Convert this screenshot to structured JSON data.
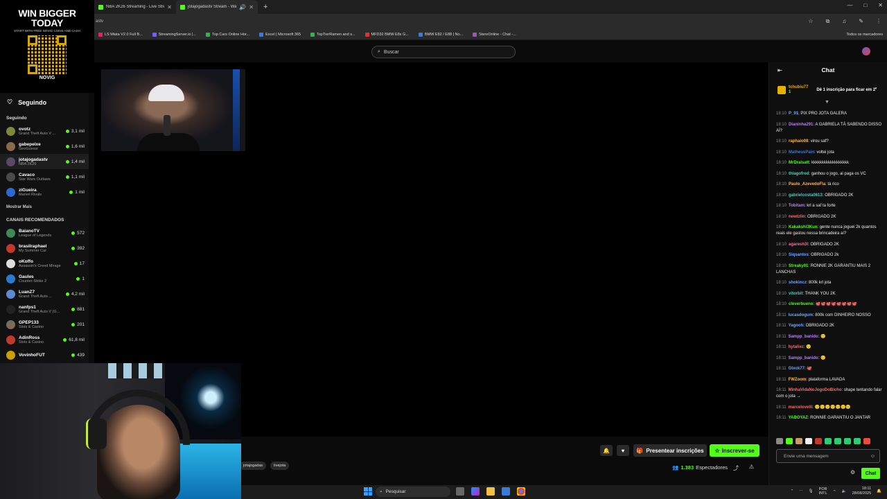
{
  "browser": {
    "tabs": [
      {
        "title": "NBA 2K26 Streaming - Live Stre",
        "active": false
      },
      {
        "title": "jotajogadastv Stream - Wa",
        "active": true
      }
    ],
    "new_tab": "+",
    "window_controls": [
      "—",
      "□",
      "✕"
    ],
    "address": "astv",
    "bookmarks": [
      {
        "label": "LS Miata V2.0 Full B...",
        "color": "#e0245e"
      },
      {
        "label": "StreamingServer.io |...",
        "color": "#7b5cff"
      },
      {
        "label": "Top Cars Online Hor...",
        "color": "#36b24a"
      },
      {
        "label": "Excel | Microsoft 365",
        "color": "#3a7bd5"
      },
      {
        "label": "TopTierRamen and s...",
        "color": "#36b24a"
      },
      {
        "label": "MFD32 BMW E8x G...",
        "color": "#d33"
      },
      {
        "label": "BMW E82 / E88 | No...",
        "color": "#3a7bd5"
      },
      {
        "label": "StereOnline - Chat -...",
        "color": "#9b59b6"
      }
    ],
    "all_bookmarks": "Todos os marcadores"
  },
  "ad": {
    "headline_1": "WIN BIGGER",
    "headline_2": "TODAY",
    "tagline": "START WITH FREE NOVIG COINS AND CASH",
    "brand": "NOVIG"
  },
  "search": {
    "placeholder": "Buscar"
  },
  "sidebar": {
    "following_title": "Seguindo",
    "section_following": "Seguindo",
    "following": [
      {
        "name": "ovotz",
        "game": "Grand Theft Auto V ...",
        "viewers": "3,1 mil",
        "color": "#7a8a3a"
      },
      {
        "name": "gabepeixe",
        "game": "GeoGuessr",
        "viewers": "1,6 mil",
        "color": "#8a6a4a"
      },
      {
        "name": "jotajogadastv",
        "game": "NBA 2K26",
        "viewers": "1,4 mil",
        "color": "#5a4a6a"
      },
      {
        "name": "Cavaco",
        "game": "Star Wars Outlaws",
        "viewers": "1,1 mil",
        "color": "#4a4a4a"
      },
      {
        "name": "ziGueira",
        "game": "Marvel Rivals",
        "viewers": "1 mil",
        "color": "#2a6ad0"
      }
    ],
    "show_more": "Mostrar Mais",
    "section_recommended": "CANAIS RECOMENDADOS",
    "recommended": [
      {
        "name": "BaianoTV",
        "game": "League of Legends",
        "viewers": "572",
        "color": "#3a8a5a"
      },
      {
        "name": "brasilraphael",
        "game": "My Summer Car",
        "viewers": "392",
        "color": "#c0392b"
      },
      {
        "name": "oKoffo",
        "game": "Assassin's Creed Mirage",
        "viewers": "17",
        "color": "#ddd"
      },
      {
        "name": "Gaules",
        "game": "Counter-Strike 2",
        "viewers": "1",
        "color": "#2a7ad0"
      },
      {
        "name": "LuanZ7",
        "game": "Grand Theft Auto ...",
        "viewers": "4,2 mil",
        "color": "#5a8ad0"
      },
      {
        "name": "nanfps1",
        "game": "Grand Theft Auto V (G...",
        "viewers": "881",
        "color": "#222"
      },
      {
        "name": "GPEP133",
        "game": "Slots & Casino",
        "viewers": "201",
        "color": "#7a6a5a"
      },
      {
        "name": "AdinRoss",
        "game": "Slots & Casino",
        "viewers": "61,8 mil",
        "color": "#c0392b"
      },
      {
        "name": "VovinhoFUT",
        "game": "",
        "viewers": "439",
        "color": "#c8a000"
      }
    ]
  },
  "stream": {
    "tags": [
      "jotajogadas",
      "livejota"
    ],
    "gift_label": "Presentear inscrições",
    "subscribe_label": "Inscrever-se",
    "viewer_count": "1.383",
    "viewers_label": "Espectadores"
  },
  "chat": {
    "title": "Chat",
    "pinned_user": "tchubiu77",
    "pinned_count": "1",
    "pinned_cta": "Dê 1 inscrição para ficar em 2º",
    "messages": [
      {
        "ts": "18:10",
        "user": "P_91",
        "color": "#6fa8ff",
        "text": "PIX PRO JOTA GALERA"
      },
      {
        "ts": "18:10",
        "user": "Dianinha291",
        "color": "#c07bff",
        "text": "A GABRIELA TÁ SABENDO DISSO AÍ?"
      },
      {
        "ts": "18:10",
        "user": "raphaio08",
        "color": "#ffb84d",
        "text": "virou saf?"
      },
      {
        "ts": "18:10",
        "user": "MatheusPain",
        "color": "#3a7bd5",
        "text": "voltei jota"
      },
      {
        "ts": "18:10",
        "user": "MrDraisatt",
        "color": "#53fc18",
        "text": "kkkkkkkkkkkkkkkkkk"
      },
      {
        "ts": "18:10",
        "user": "thiagofred",
        "color": "#4dd0c8",
        "text": "ganhou o jogo, ai paga os VC"
      },
      {
        "ts": "18:10",
        "user": "Paulo_AzevedoFla",
        "color": "#ffb84d",
        "text": "tá rico"
      },
      {
        "ts": "18:10",
        "user": "gabrielcosta0613",
        "color": "#4dd0c8",
        "text": "OBRIGADO 2K"
      },
      {
        "ts": "18:10",
        "user": "Tobitam",
        "color": "#c07bff",
        "text": "krl a saf ta forte"
      },
      {
        "ts": "18:10",
        "user": "newtzlin",
        "color": "#ff6b6b",
        "text": "OBRIGADO 2K"
      },
      {
        "ts": "18:10",
        "user": "Kakakshi3Kun",
        "color": "#53fc18",
        "text": "gente nunca joguei 2k quantos reais ele gastou nessa brincadeira aí?"
      },
      {
        "ts": "18:10",
        "user": "agaresh3l",
        "color": "#ff6b9a",
        "text": "OBRIGADO 2K"
      },
      {
        "ts": "18:10",
        "user": "Siqsantos",
        "color": "#6fa8ff",
        "text": "OBRIGADO 2k"
      },
      {
        "ts": "18:10",
        "user": "Streaky01",
        "color": "#53fc18",
        "text": "RONNIE 2K GARANTIU MAIS 2 LANCHAS"
      },
      {
        "ts": "18:10",
        "user": "shokincz",
        "color": "#6fa8ff",
        "text": "800k krl jota"
      },
      {
        "ts": "18:10",
        "user": "vitorbit",
        "color": "#4dd0c8",
        "text": "THANK YOU 2K"
      },
      {
        "ts": "18:10",
        "user": "cleverbueno",
        "color": "#53fc18",
        "text": "🐙🐙🐙🐙🐙🐙🐙🐙"
      },
      {
        "ts": "18:11",
        "user": "lucasdogum",
        "color": "#6fa8ff",
        "text": "800k com DINHEIRO NOSSO"
      },
      {
        "ts": "18:11",
        "user": "Yagooh",
        "color": "#6fa8ff",
        "text": "OBRIGADO 2K"
      },
      {
        "ts": "18:11",
        "user": "Sampp_banido",
        "color": "#c07bff",
        "text": "🙂"
      },
      {
        "ts": "18:11",
        "user": "hytalixc",
        "color": "#ff6b6b",
        "text": "🙂"
      },
      {
        "ts": "18:11",
        "user": "Sampp_banido",
        "color": "#c07bff",
        "text": "🙂"
      },
      {
        "ts": "18:11",
        "user": "Gtxck77",
        "color": "#6fa8ff",
        "text": "🐙"
      },
      {
        "ts": "18:11",
        "user": "FWZoom",
        "color": "#ffb84d",
        "text": "plataforma LAVADA"
      },
      {
        "ts": "18:11",
        "user": "MinhaVidaNoJogoDoBicho",
        "color": "#ff6b6b",
        "text": "shape tentando falar com o jota →"
      },
      {
        "ts": "18:11",
        "user": "marcelovelli",
        "color": "#ff6b6b",
        "text": "🙂🙂🙂🙂🙂🙂🙂"
      },
      {
        "ts": "18:11",
        "user": "YABOYAZ",
        "color": "#53fc18",
        "text": "RONNIE GARANTIU O JANTAR"
      }
    ],
    "input_placeholder": "Envie uma mensagem",
    "send_label": "Chat"
  },
  "taskbar": {
    "search_placeholder": "Pesquisar",
    "lang_1": "POR",
    "lang_2": "INTL",
    "time": "18:11",
    "date": "28/08/2025"
  }
}
